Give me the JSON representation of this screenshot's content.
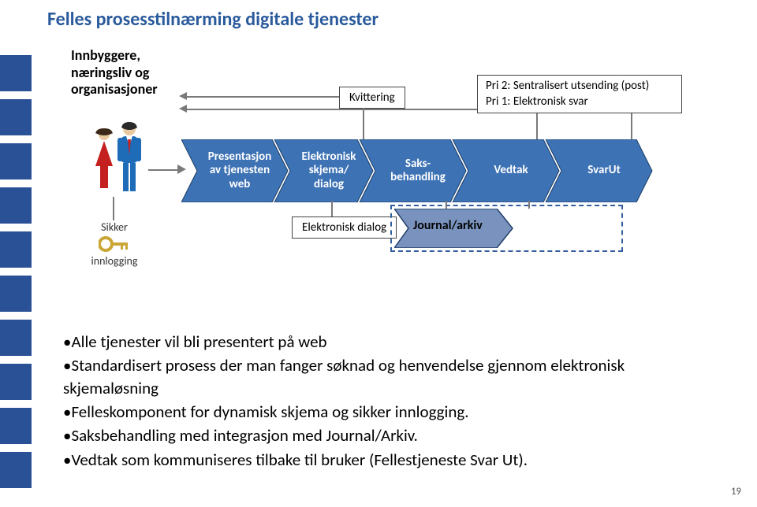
{
  "title": "Felles prosesstilnærming digitale tjenester",
  "actors_label": "Innbyggere, næringsliv og organisasjoner",
  "sikker_label": "Sikker",
  "innlogging_label": "innlogging",
  "chevrons": {
    "c1": "Presentasjon av tjenesten web",
    "c2": "Elektronisk skjema/ dialog",
    "c3": "Saks- behandling",
    "c4": "Vedtak",
    "c5": "SvarUt"
  },
  "kvittering": "Kvittering",
  "pri_line1": "Pri 2: Sentralisert utsending (post)",
  "pri_line2": "Pri 1: Elektronisk svar",
  "edialog": "Elektronisk dialog",
  "journal": "Journal/arkiv",
  "bullets": {
    "b1": "Alle tjenester vil bli presentert på web",
    "b2": "Standardisert prosess der man fanger søknad og henvendelse gjennom elektronisk skjemaløsning",
    "b3": "Felleskomponent for dynamisk skjema og sikker innlogging.",
    "b4": "Saksbehandling med integrasjon med Journal/Arkiv.",
    "b5": "Vedtak som kommuniseres tilbake til bruker (Fellestjeneste Svar Ut)."
  },
  "page_number": "19"
}
